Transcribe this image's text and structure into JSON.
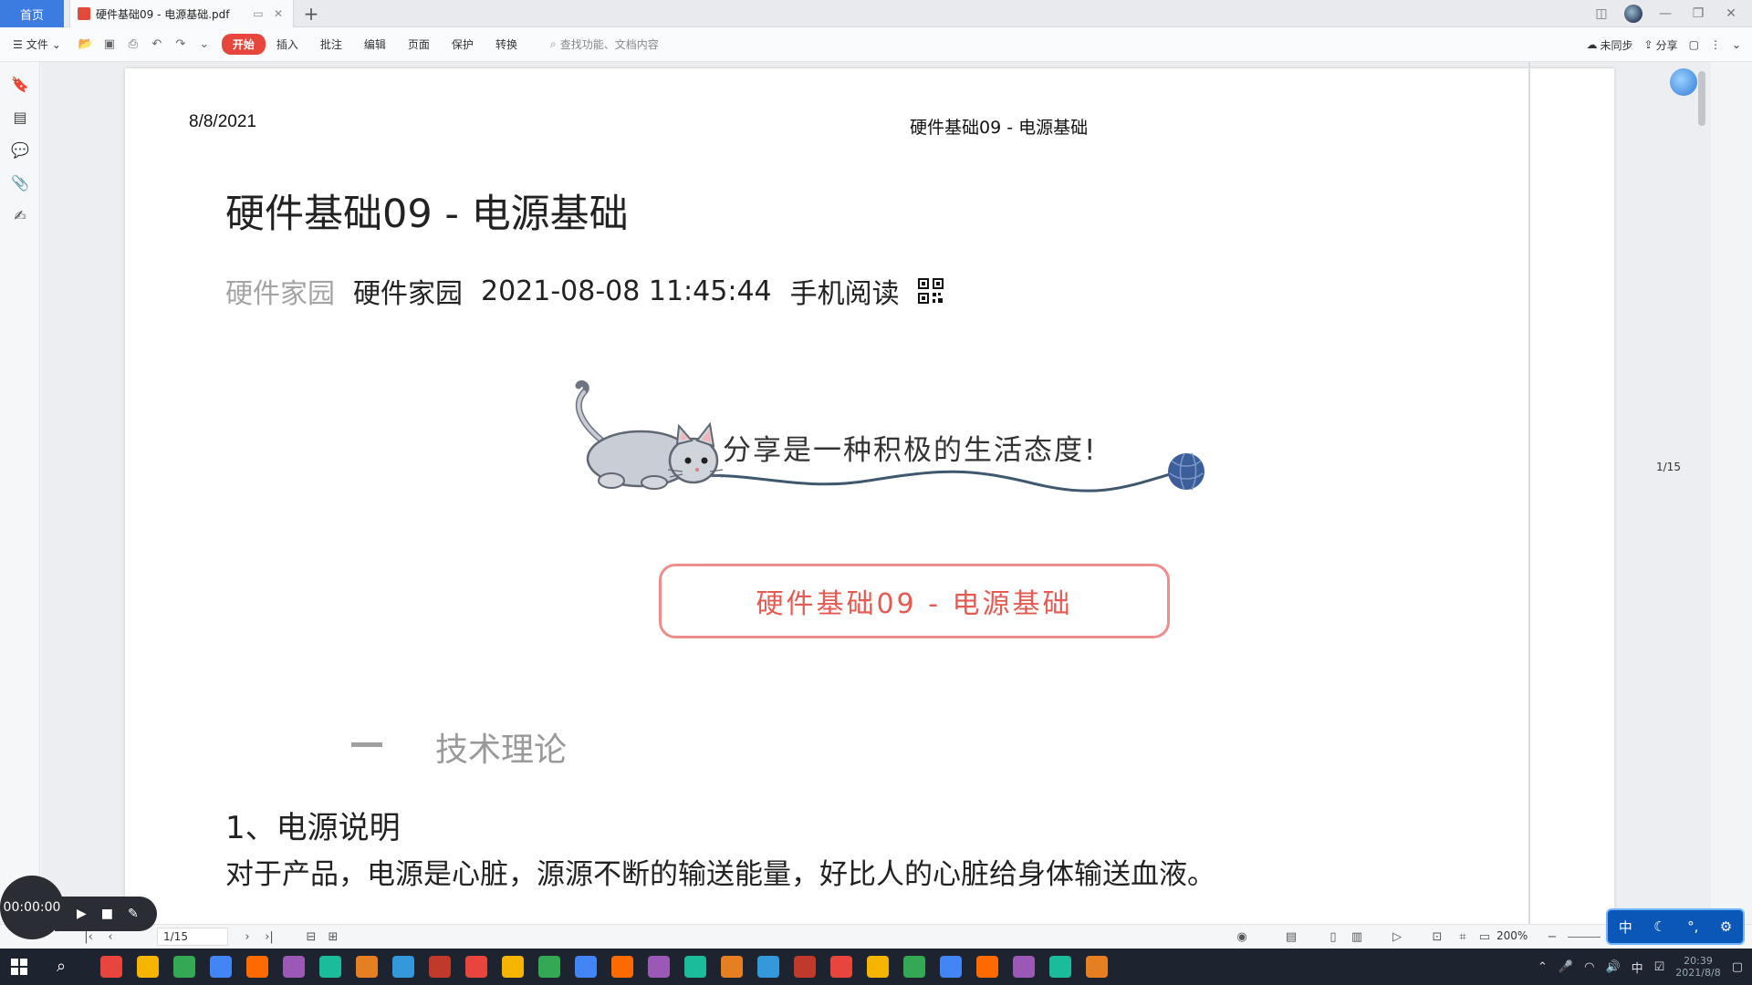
{
  "tabs": {
    "home": "首页",
    "document": "硬件基础09 - 电源基础.pdf"
  },
  "toolbar": {
    "file_label": "文件",
    "menus": [
      "开始",
      "插入",
      "批注",
      "编辑",
      "页面",
      "保护",
      "转换"
    ],
    "active_menu": "开始",
    "search_placeholder": "查找功能、文档内容",
    "sync_label": "未同步",
    "share_label": "分享"
  },
  "document": {
    "header_date": "8/8/2021",
    "header_title": "硬件基础09 - 电源基础",
    "title": "硬件基础09 - 电源基础",
    "author_muted": "硬件家园",
    "author": "硬件家园",
    "datetime": "2021-08-08 11:45:44",
    "mobile_read": "手机阅读",
    "slogan": "分享是一种积极的生活态度!",
    "boxed_title": "硬件基础09 - 电源基础",
    "section_title": "技术理论",
    "heading": "1、电源说明",
    "paragraph": "对于产品，电源是心脏，源源不断的输送能量，好比人的心脏给身体输送血液。"
  },
  "page_counter": "1/15",
  "statusbar": {
    "page_input": "1/15",
    "zoom": "200%"
  },
  "recorder": {
    "time": "00:00:00"
  },
  "ime": {
    "mode": "中"
  },
  "tray": {
    "lang": "中",
    "time": "20:39",
    "date": "2021/8/8"
  },
  "colors": {
    "accent": "#3c7be0",
    "active_menu": "#e6463c",
    "box_border": "#ef8c8c",
    "box_text": "#e55a51",
    "taskbar": "#1d2430"
  },
  "taskbar_apps": [
    "start",
    "search",
    "chrome",
    "chrome-alt",
    "app-green",
    "app-red",
    "file-explorer",
    "search-orange",
    "sticky-notes",
    "app-orange",
    "zoom",
    "photo",
    "app",
    "app",
    "image",
    "app",
    "excel",
    "tool",
    "app",
    "building",
    "browser",
    "mx",
    "app",
    "app",
    "iqiyi",
    "visual-studio",
    "wechat",
    "qq",
    "app",
    "wps"
  ]
}
